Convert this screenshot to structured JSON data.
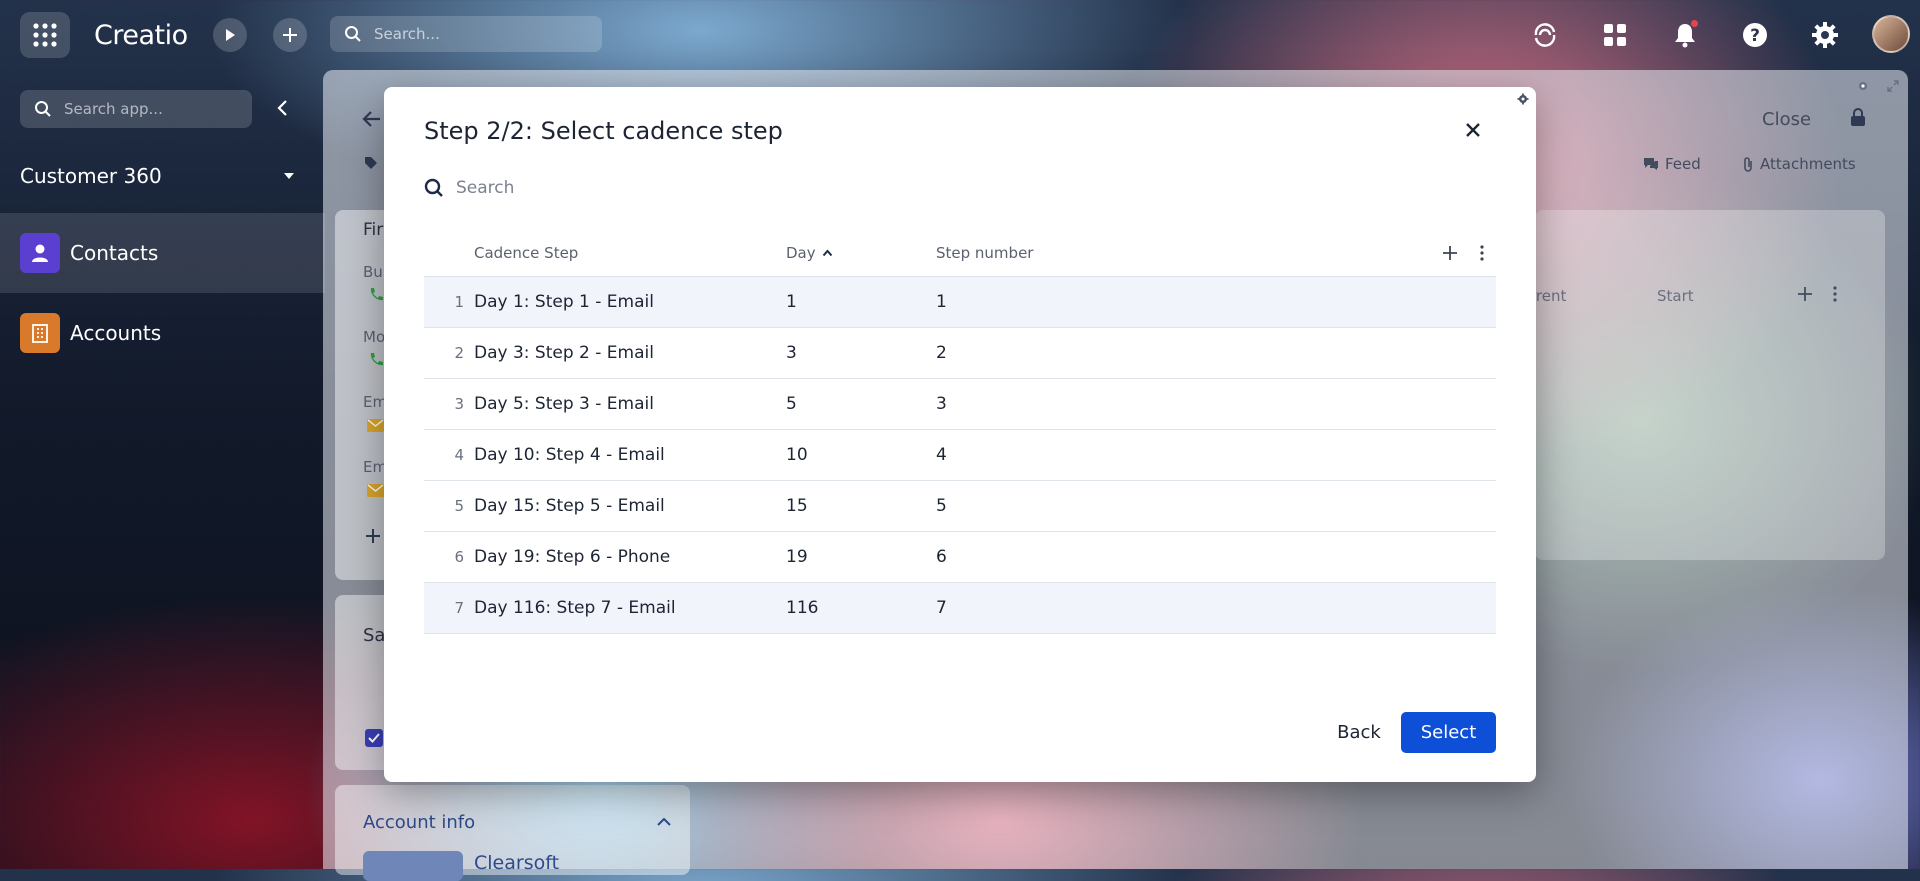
{
  "topbar": {
    "brand": "Creatio",
    "search_placeholder": "Search..."
  },
  "sidebar": {
    "search_placeholder": "Search app...",
    "workspace": "Customer 360",
    "items": [
      {
        "label": "Contacts",
        "icon": "person-icon",
        "color": "#5b3fd0"
      },
      {
        "label": "Accounts",
        "icon": "building-icon",
        "color": "#d9792a"
      }
    ]
  },
  "background": {
    "close_label": "Close",
    "feed_label": "Feed",
    "attachments_label": "Attachments",
    "col_current": "rrent",
    "col_start": "Start",
    "account_info": "Account info",
    "company": "Clearsoft",
    "section_sa": "Sa",
    "first": "Fir",
    "bu": "Bu",
    "mo": "Mo",
    "em1": "Em",
    "em2": "Em"
  },
  "modal": {
    "title": "Step 2/2: Select cadence step",
    "search_placeholder": "Search",
    "columns": {
      "cadence_step": "Cadence Step",
      "day": "Day",
      "step_number": "Step number"
    },
    "rows": [
      {
        "n": "1",
        "step": "Day 1: Step 1 - Email",
        "day": "1",
        "num": "1"
      },
      {
        "n": "2",
        "step": "Day 3: Step 2 - Email",
        "day": "3",
        "num": "2"
      },
      {
        "n": "3",
        "step": "Day 5: Step 3 - Email",
        "day": "5",
        "num": "3"
      },
      {
        "n": "4",
        "step": "Day 10: Step 4 - Email",
        "day": "10",
        "num": "4"
      },
      {
        "n": "5",
        "step": "Day 15: Step 5 - Email",
        "day": "15",
        "num": "5"
      },
      {
        "n": "6",
        "step": "Day 19: Step 6 - Phone",
        "day": "19",
        "num": "6"
      },
      {
        "n": "7",
        "step": "Day 116: Step 7 - Email",
        "day": "116",
        "num": "7"
      }
    ],
    "back_label": "Back",
    "select_label": "Select",
    "accent": "#0d4fd6"
  }
}
